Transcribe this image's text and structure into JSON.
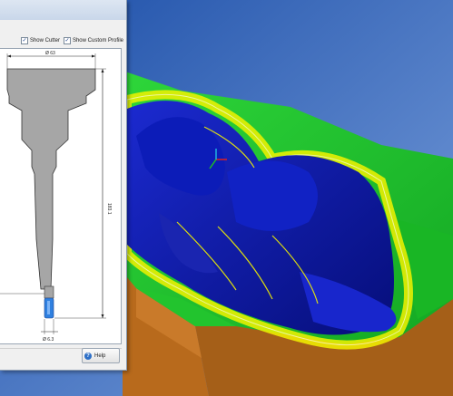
{
  "dialog": {
    "show_cutter_label": "Show Cutter",
    "show_custom_profile_label": "Show Custom Profile",
    "show_cutter_checked": true,
    "show_custom_profile_checked": true,
    "help_label": "Help"
  },
  "profile": {
    "top_diameter_label": "Ø 63",
    "tip_diameter_label": "Ø 6.3",
    "length_label": "183.1"
  },
  "colors": {
    "viewport_background_top": "#1d4fa8",
    "viewport_background_bottom": "#6d95d8",
    "part_blue": "#0a17a8",
    "stock_green": "#1fbf2a",
    "stock_brown": "#b86a1c",
    "toolpath_yellow": "#f2f200",
    "holder_gray": "#a6a6a6",
    "cutter_blue": "#2f80e0"
  }
}
